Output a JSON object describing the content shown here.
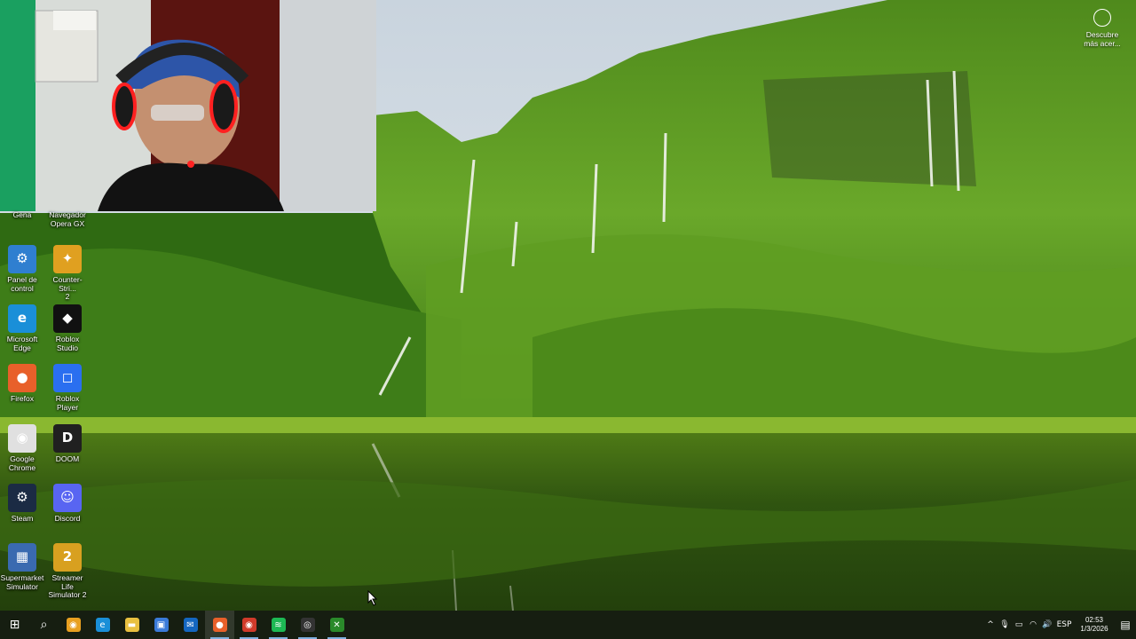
{
  "desktop": {
    "icons": [
      {
        "id": "gena",
        "label": "Gena",
        "color": "#4a6a30",
        "glyph": ""
      },
      {
        "id": "opera-gx",
        "label": "Navegador\nOpera GX",
        "color": "#c0152f",
        "glyph": "O"
      },
      {
        "id": "panel-control",
        "label": "Panel de\ncontrol",
        "color": "#2f7fd0",
        "glyph": "⚙"
      },
      {
        "id": "counter-strike",
        "label": "Counter-Stri...\n2",
        "color": "#e0a020",
        "glyph": "✦"
      },
      {
        "id": "edge",
        "label": "Microsoft\nEdge",
        "color": "#1a8fd8",
        "glyph": "e"
      },
      {
        "id": "roblox-studio",
        "label": "Roblox\nStudio",
        "color": "#111111",
        "glyph": "◆"
      },
      {
        "id": "firefox",
        "label": "Firefox",
        "color": "#e8602a",
        "glyph": "●"
      },
      {
        "id": "roblox-player",
        "label": "Roblox Player",
        "color": "#2a6ff0",
        "glyph": "◻"
      },
      {
        "id": "chrome",
        "label": "Google\nChrome",
        "color": "#e0e0e0",
        "glyph": "◉"
      },
      {
        "id": "doom",
        "label": "DOOM",
        "color": "#202020",
        "glyph": "D"
      },
      {
        "id": "steam",
        "label": "Steam",
        "color": "#1b2b44",
        "glyph": "⚙"
      },
      {
        "id": "discord",
        "label": "Discord",
        "color": "#5865f2",
        "glyph": "☺"
      },
      {
        "id": "supermarket",
        "label": "Supermarket\nSimulator",
        "color": "#3a6ab0",
        "glyph": "▦"
      },
      {
        "id": "streamer-life",
        "label": "Streamer Life\nSimulator 2",
        "color": "#d8a020",
        "glyph": "2"
      }
    ],
    "discover": {
      "label": "Descubre\nmás acer..."
    }
  },
  "taskbar": {
    "apps": [
      {
        "id": "start",
        "icon": "windows-start-icon",
        "glyph": "⊞",
        "color": "transparent"
      },
      {
        "id": "search",
        "icon": "search-icon",
        "glyph": "⌕",
        "color": "transparent"
      },
      {
        "id": "chrome-dev",
        "icon": "chrome-icon",
        "glyph": "◉",
        "color": "#e8a020"
      },
      {
        "id": "edge",
        "icon": "edge-icon",
        "glyph": "e",
        "color": "#1a8fd8"
      },
      {
        "id": "explorer",
        "icon": "folder-icon",
        "glyph": "▬",
        "color": "#e8c040"
      },
      {
        "id": "store",
        "icon": "store-icon",
        "glyph": "▣",
        "color": "#3a7ad8"
      },
      {
        "id": "outlook",
        "icon": "mail-icon",
        "glyph": "✉",
        "color": "#1466c0"
      },
      {
        "id": "firefox",
        "icon": "firefox-icon",
        "glyph": "●",
        "color": "#e8602a"
      },
      {
        "id": "chrome",
        "icon": "chrome-icon",
        "glyph": "◉",
        "color": "#d03a2a"
      },
      {
        "id": "spotify",
        "icon": "spotify-icon",
        "glyph": "≋",
        "color": "#1db954"
      },
      {
        "id": "obs",
        "icon": "obs-icon",
        "glyph": "◎",
        "color": "#333333"
      },
      {
        "id": "xbox",
        "icon": "xbox-icon",
        "glyph": "✕",
        "color": "#2a8a2a"
      }
    ],
    "tray": {
      "chevron": "^",
      "language": "ESP",
      "time": "02:53",
      "date": "1/3/2026"
    }
  }
}
